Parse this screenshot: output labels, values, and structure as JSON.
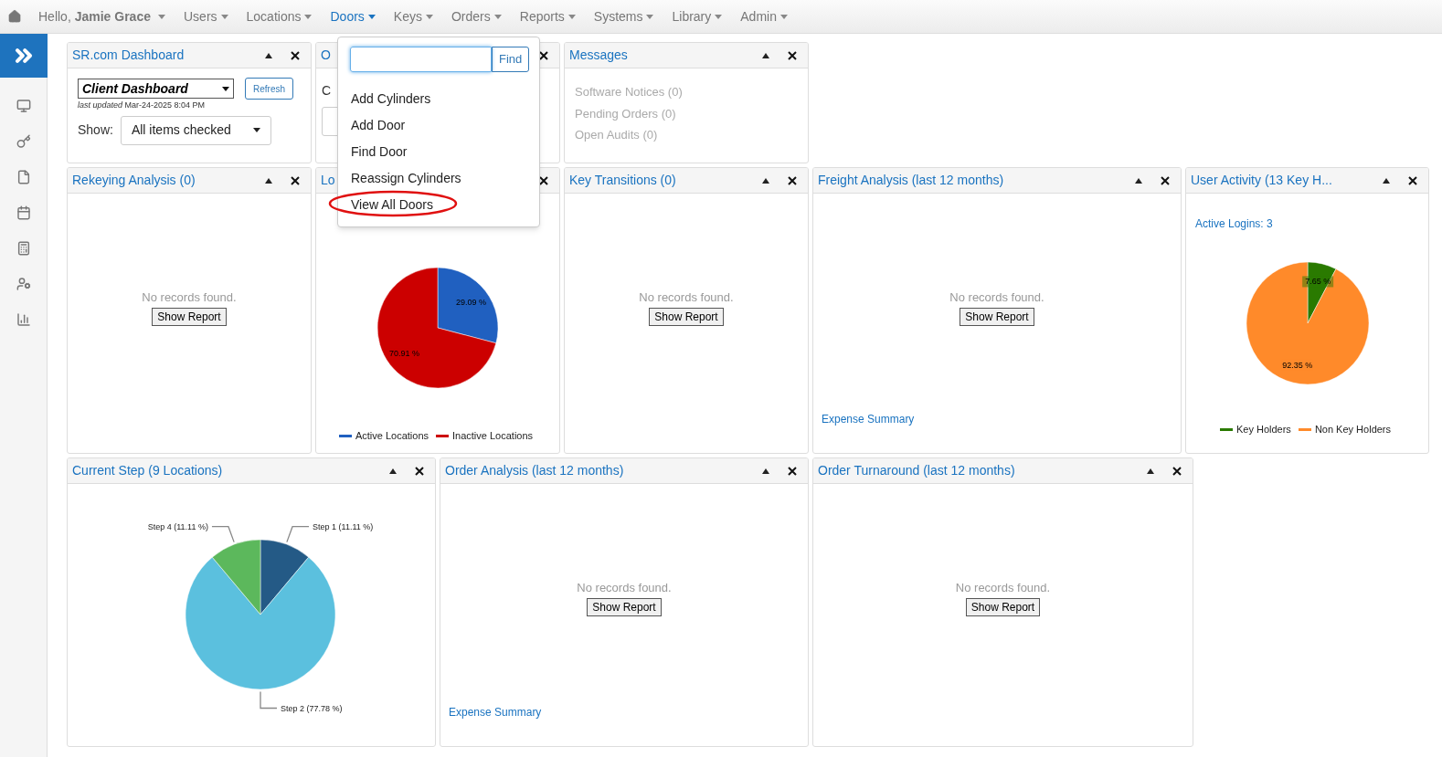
{
  "nav": {
    "greeting": "Hello, **Jamie Grace**",
    "items": [
      {
        "label": "Users",
        "selected": false
      },
      {
        "label": "Locations",
        "selected": false
      },
      {
        "label": "Doors",
        "selected": true
      },
      {
        "label": "Keys",
        "selected": false
      },
      {
        "label": "Orders",
        "selected": false
      },
      {
        "label": "Reports",
        "selected": false
      },
      {
        "label": "Systems",
        "selected": false
      },
      {
        "label": "Library",
        "selected": false
      },
      {
        "label": "Admin",
        "selected": false
      }
    ]
  },
  "dropdown": {
    "button": "Find",
    "items": [
      {
        "label": "Add Cylinders",
        "circled": false
      },
      {
        "label": "Add Door",
        "circled": false
      },
      {
        "label": "Find Door",
        "circled": false
      },
      {
        "label": "Reassign Cylinders",
        "circled": false
      },
      {
        "label": "View All Doors",
        "circled": true
      }
    ]
  },
  "rows": [
    [
      {
        "kind": "dashboard",
        "title": "SR.com Dashboard",
        "select": "Client Dashboard",
        "refresh": "Refresh",
        "updated": "*last updated* Mar-24-2025 8:04 PM",
        "show_label": "Show:",
        "show_value": "All items checked"
      },
      {
        "kind": "covered",
        "title": "O",
        "text": "C"
      },
      {
        "kind": "messages",
        "title": "Messages",
        "items": [
          "Software Notices (0)",
          "Pending Orders (0)",
          "Open Audits (0)"
        ]
      }
    ],
    [
      {
        "kind": "empty",
        "title": "Rekeying Analysis (0)",
        "message": "No records found.",
        "button": "Show Report"
      },
      {
        "kind": "pie",
        "title": "Lo",
        "chart_data": {
          "type": "pie",
          "categories": [
            "Active Locations",
            "Inactive Locations"
          ],
          "values": [
            29.09,
            70.91
          ],
          "colors": [
            "#2060c0",
            "#cc0000"
          ],
          "data_labels": true,
          "value_labels": [
            "29.09 %",
            "70.91 %"
          ]
        }
      },
      {
        "kind": "empty",
        "title": "Key Transitions (0)",
        "message": "No records found.",
        "button": "Show Report"
      },
      {
        "kind": "empty",
        "title": "Freight Analysis (last 12 months)",
        "message": "No records found.",
        "button": "Show Report",
        "link": "Expense Summary"
      },
      {
        "kind": "pie",
        "title": "User Activity (13 Key H...",
        "note": "Active Logins: 3",
        "chart_data": {
          "type": "pie",
          "categories": [
            "Key Holders",
            "Non Key Holders"
          ],
          "values": [
            7.65,
            92.35
          ],
          "colors": [
            "#2a7a00",
            "#ff8a2a"
          ],
          "data_labels": true,
          "value_labels": [
            "7.65 %",
            "92.35 %"
          ]
        }
      }
    ],
    [
      {
        "kind": "steps",
        "title": "Current Step (9 Locations)",
        "chart_data": {
          "type": "pie",
          "categories": [
            "Step 1",
            "Step 2",
            "Step 4"
          ],
          "values": [
            11.11,
            77.78,
            11.11
          ],
          "colors": [
            "#245a86",
            "#5bc0de",
            "#5cb85c"
          ],
          "data_labels": true,
          "value_labels": [
            "(11.11 %)",
            "(77.78 %)",
            "(11.11 %)"
          ]
        }
      },
      {
        "kind": "empty",
        "title": "Order Analysis (last 12 months)",
        "message": "No records found.",
        "button": "Show Report",
        "link": "Expense Summary"
      },
      {
        "kind": "empty",
        "title": "Order Turnaround (last 12 months)",
        "message": "No records found.",
        "button": "Show Report"
      }
    ]
  ]
}
